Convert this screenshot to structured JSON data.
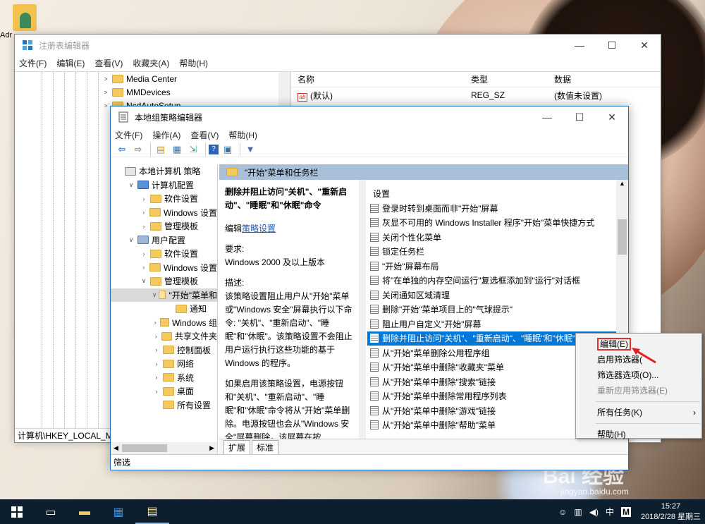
{
  "desktop": {
    "icon_label": "Adr",
    "watermark": "Bai 经验",
    "watermark_url": "jingyan.baidu.com"
  },
  "regedit": {
    "title": "注册表编辑器",
    "menu": [
      "文件(F)",
      "编辑(E)",
      "查看(V)",
      "收藏夹(A)",
      "帮助(H)"
    ],
    "tree": [
      "Media Center",
      "MMDevices",
      "NcdAutoSetup"
    ],
    "columns": {
      "name": "名称",
      "type": "类型",
      "data": "数据"
    },
    "rows": [
      {
        "name": "(默认)",
        "type": "REG_SZ",
        "data": "(数值未设置)"
      }
    ],
    "status": "计算机\\HKEY_LOCAL_MA"
  },
  "gpedit": {
    "title": "本地组策略编辑器",
    "menu": [
      "文件(F)",
      "操作(A)",
      "查看(V)",
      "帮助(H)"
    ],
    "tree": [
      {
        "label": "本地计算机 策略",
        "indent": 0,
        "caret": "",
        "type": "root"
      },
      {
        "label": "计算机配置",
        "indent": 1,
        "caret": "v",
        "type": "pc"
      },
      {
        "label": "软件设置",
        "indent": 2,
        "caret": ">",
        "type": "folder"
      },
      {
        "label": "Windows 设置",
        "indent": 2,
        "caret": ">",
        "type": "folder"
      },
      {
        "label": "管理模板",
        "indent": 2,
        "caret": ">",
        "type": "folder"
      },
      {
        "label": "用户配置",
        "indent": 1,
        "caret": "v",
        "type": "user"
      },
      {
        "label": "软件设置",
        "indent": 2,
        "caret": ">",
        "type": "folder"
      },
      {
        "label": "Windows 设置",
        "indent": 2,
        "caret": ">",
        "type": "folder"
      },
      {
        "label": "管理模板",
        "indent": 2,
        "caret": "v",
        "type": "folder"
      },
      {
        "label": "\"开始\"菜单和",
        "indent": 3,
        "caret": "v",
        "type": "open",
        "selected": true
      },
      {
        "label": "通知",
        "indent": 4,
        "caret": "",
        "type": "folder"
      },
      {
        "label": "Windows 组",
        "indent": 3,
        "caret": ">",
        "type": "folder"
      },
      {
        "label": "共享文件夹",
        "indent": 3,
        "caret": ">",
        "type": "folder"
      },
      {
        "label": "控制面板",
        "indent": 3,
        "caret": ">",
        "type": "folder"
      },
      {
        "label": "网络",
        "indent": 3,
        "caret": ">",
        "type": "folder"
      },
      {
        "label": "系统",
        "indent": 3,
        "caret": ">",
        "type": "folder"
      },
      {
        "label": "桌面",
        "indent": 3,
        "caret": ">",
        "type": "folder"
      },
      {
        "label": "所有设置",
        "indent": 3,
        "caret": "",
        "type": "folder"
      }
    ],
    "header": "\"开始\"菜单和任务栏",
    "desc": {
      "title": "删除并阻止访问\"关机\"、\"重新启动\"、\"睡眠\"和\"休眠\"命令",
      "edit_prefix": "编辑",
      "edit_link": "策略设置",
      "req_label": "要求:",
      "req_value": "Windows 2000 及以上版本",
      "desc_label": "描述:",
      "desc_text": "该策略设置阻止用户从\"开始\"菜单或\"Windows 安全\"屏幕执行以下命令: \"关机\"、\"重新启动\"、\"睡眠\"和\"休眠\"。该策略设置不会阻止用户运行执行这些功能的基于 Windows 的程序。",
      "more_text": "如果启用该策略设置，电源按钮和\"关机\"、\"重新启动\"、\"睡眠\"和\"休眠\"命令将从\"开始\"菜单删除。电源按钮也会从\"Windows 安全\"屏幕删除，该屏幕在按 CTRL+ALT+DELETE 时出现"
    },
    "list_header": "设置",
    "items": [
      "登录时转到桌面而非\"开始\"屏幕",
      "灰显不可用的 Windows Installer 程序\"开始\"菜单快捷方式",
      "关闭个性化菜单",
      "锁定任务栏",
      "\"开始\"屏幕布局",
      "将\"在单独的内存空间运行\"复选框添加到\"运行\"对话框",
      "关闭通知区域清理",
      "删除\"开始\"菜单项目上的\"气球提示\"",
      "阻止用户自定义\"开始\"屏幕",
      "删除并阻止访问\"关机\"、\"重新启动\"、\"睡眠\"和\"休眠\"命令",
      "从\"开始\"菜单删除公用程序组",
      "从\"开始\"菜单中删除\"收藏夹\"菜单",
      "从\"开始\"菜单中删除\"搜索\"链接",
      "从\"开始\"菜单中删除常用程序列表",
      "从\"开始\"菜单中删除\"游戏\"链接",
      "从\"开始\"菜单中删除\"帮助\"菜单"
    ],
    "selected_index": 9,
    "tabs": [
      "扩展",
      "标准"
    ],
    "status": "筛选"
  },
  "context_menu": {
    "edit": "编辑(E)",
    "enable_filter": "启用筛选器(",
    "filter_options": "筛选器选项(O)...",
    "reapply_filter": "重新应用筛选器(E)",
    "all_tasks": "所有任务(K)",
    "help": "帮助(H)"
  },
  "taskbar": {
    "time": "15:27",
    "date": "2018/2/28 星期三",
    "ime": "中",
    "ime2": "M"
  }
}
